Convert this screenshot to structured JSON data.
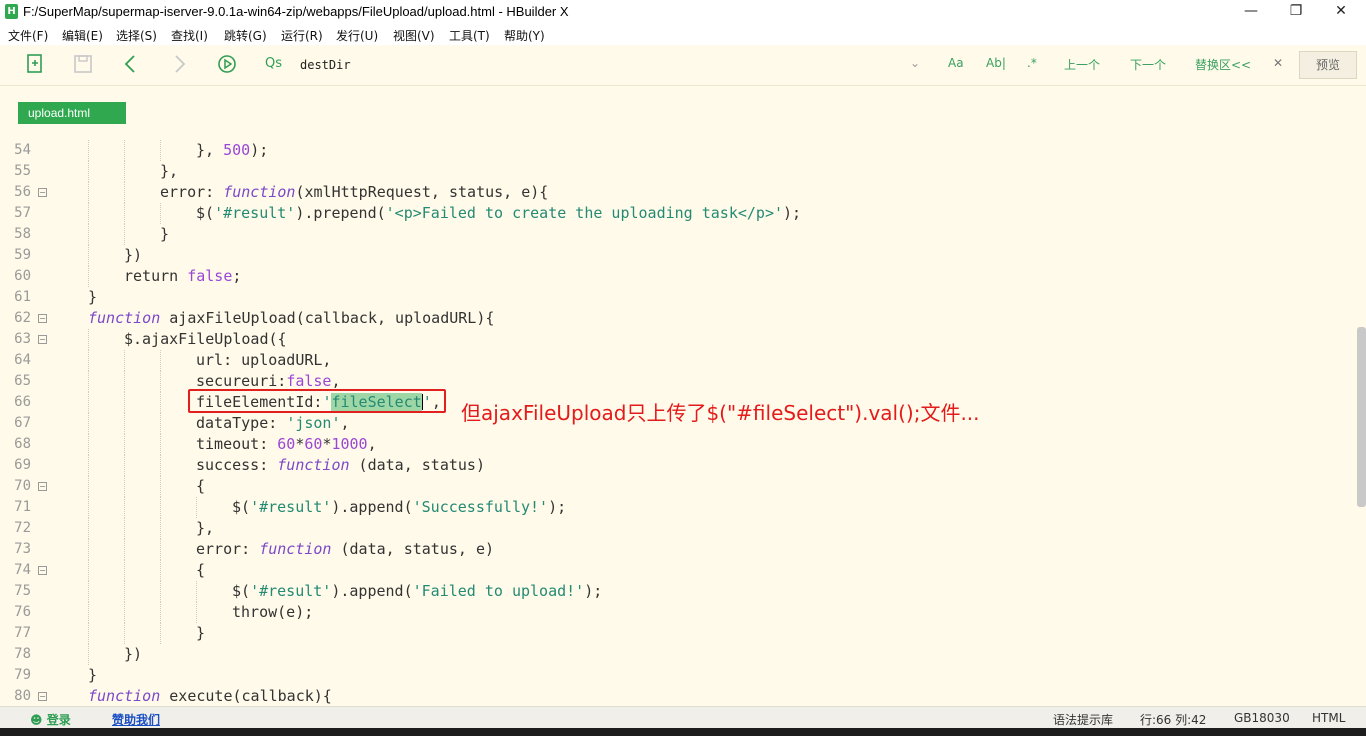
{
  "window": {
    "title": "F:/SuperMap/supermap-iserver-9.0.1a-win64-zip/webapps/FileUpload/upload.html - HBuilder X",
    "app_icon_letter": "H",
    "minimize": "—",
    "restore": "❐",
    "close": "✕"
  },
  "menu": {
    "items": [
      "文件(F)",
      "编辑(E)",
      "选择(S)",
      "查找(I)",
      "跳转(G)",
      "运行(R)",
      "发行(U)",
      "视图(V)",
      "工具(T)",
      "帮助(Y)"
    ]
  },
  "toolbar": {
    "icons": [
      "new-file-icon",
      "save-icon",
      "back-icon",
      "forward-icon",
      "run-icon"
    ],
    "find_icon": "Qs",
    "find_value": "destDir",
    "dropdown": "⌄",
    "match_case": "Aa",
    "whole_word": "Ab|",
    "regex": ".*",
    "prev": "上一个",
    "next": "下一个",
    "replace": "替换区<<",
    "close_find": "✕",
    "preview": "预览"
  },
  "tab": {
    "label": "upload.html"
  },
  "editor": {
    "line_numbers": [
      "54",
      "55",
      "56",
      "57",
      "58",
      "59",
      "60",
      "61",
      "62",
      "63",
      "64",
      "65",
      "66",
      "67",
      "68",
      "69",
      "70",
      "71",
      "72",
      "73",
      "74",
      "75",
      "76",
      "77",
      "78",
      "79",
      "80"
    ]
  },
  "annotation": {
    "text": "但ajaxFileUpload只上传了$(\"#fileSelect\").val();文件..."
  },
  "statusbar": {
    "login": "登录",
    "sponsor": "赞助我们",
    "syntax_hint": "语法提示库",
    "position": "行:66  列:42",
    "encoding": "GB18030",
    "language": "HTML"
  }
}
